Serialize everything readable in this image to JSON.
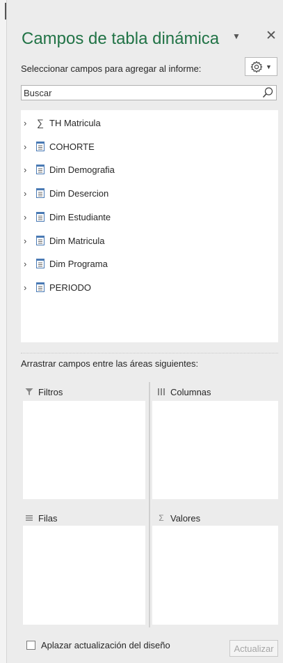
{
  "panel": {
    "title": "Campos de tabla dinámica",
    "subtitle": "Seleccionar campos para agregar al informe:",
    "search_placeholder": "Buscar"
  },
  "fields": [
    {
      "label": "TH Matricula",
      "icon": "sigma-icon"
    },
    {
      "label": "COHORTE",
      "icon": "table-icon"
    },
    {
      "label": "Dim Demografia",
      "icon": "table-icon"
    },
    {
      "label": "Dim Desercion",
      "icon": "table-icon"
    },
    {
      "label": "Dim Estudiante",
      "icon": "table-icon"
    },
    {
      "label": "Dim Matricula",
      "icon": "table-icon"
    },
    {
      "label": "Dim Programa",
      "icon": "table-icon"
    },
    {
      "label": "PERIODO",
      "icon": "table-icon"
    }
  ],
  "areas": {
    "instruction": "Arrastrar campos entre las áreas siguientes:",
    "filters_label": "Filtros",
    "columns_label": "Columnas",
    "rows_label": "Filas",
    "values_label": "Valores"
  },
  "footer": {
    "defer_label": "Aplazar actualización del diseño",
    "update_label": "Actualizar"
  },
  "colors": {
    "title": "#217346",
    "field_icon": "#4a7ab4",
    "disabled_text": "#a6a6a6"
  }
}
